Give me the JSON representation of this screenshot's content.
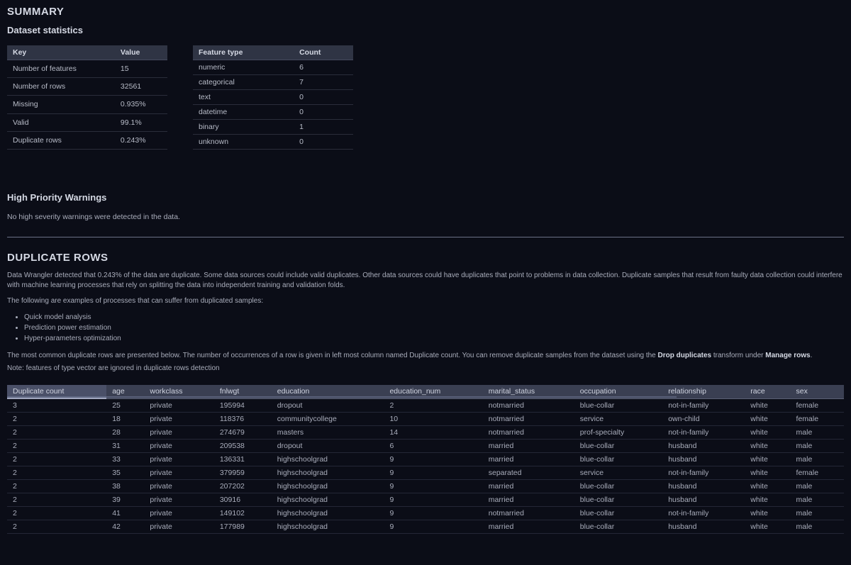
{
  "summary": {
    "title": "SUMMARY",
    "subtitle": "Dataset statistics",
    "stats_table": {
      "headers": [
        "Key",
        "Value"
      ],
      "rows": [
        [
          "Number of features",
          "15"
        ],
        [
          "Number of rows",
          "32561"
        ],
        [
          "Missing",
          "0.935%"
        ],
        [
          "Valid",
          "99.1%"
        ],
        [
          "Duplicate rows",
          "0.243%"
        ]
      ]
    },
    "types_table": {
      "headers": [
        "Feature type",
        "Count"
      ],
      "rows": [
        [
          "numeric",
          "6"
        ],
        [
          "categorical",
          "7"
        ],
        [
          "text",
          "0"
        ],
        [
          "datetime",
          "0"
        ],
        [
          "binary",
          "1"
        ],
        [
          "unknown",
          "0"
        ]
      ]
    }
  },
  "warnings": {
    "title": "High Priority Warnings",
    "message": "No high severity warnings were detected in the data."
  },
  "duplicates": {
    "title": "DUPLICATE ROWS",
    "intro": "Data Wrangler detected that 0.243% of the data are duplicate. Some data sources could include valid duplicates. Other data sources could have duplicates that point to problems in data collection. Duplicate samples that result from faulty data collection could interfere with machine learning processes that rely on splitting the data into independent training and validation folds.",
    "intro2": "The following are examples of processes that can suffer from duplicated samples:",
    "bullets": [
      "Quick model analysis",
      "Prediction power estimation",
      "Hyper-parameters optimization"
    ],
    "note1_a": "The most common duplicate rows are presented below. The number of occurrences of a row is given in left most column named Duplicate count. You can remove duplicate samples from the dataset using the ",
    "note1_b": "Drop duplicates",
    "note1_c": " transform under ",
    "note1_d": "Manage rows",
    "note1_e": ".",
    "note2": "Note: features of type vector are ignored in duplicate rows detection",
    "columns": [
      "Duplicate count",
      "age",
      "workclass",
      "fnlwgt",
      "education",
      "education_num",
      "marital_status",
      "occupation",
      "relationship",
      "race",
      "sex"
    ],
    "rows": [
      [
        "3",
        "25",
        "private",
        "195994",
        "dropout",
        "2",
        "notmarried",
        "blue-collar",
        "not-in-family",
        "white",
        "female"
      ],
      [
        "2",
        "18",
        "private",
        "118376",
        "communitycollege",
        "10",
        "notmarried",
        "service",
        "own-child",
        "white",
        "female"
      ],
      [
        "2",
        "28",
        "private",
        "274679",
        "masters",
        "14",
        "notmarried",
        "prof-specialty",
        "not-in-family",
        "white",
        "male"
      ],
      [
        "2",
        "31",
        "private",
        "209538",
        "dropout",
        "6",
        "married",
        "blue-collar",
        "husband",
        "white",
        "male"
      ],
      [
        "2",
        "33",
        "private",
        "136331",
        "highschoolgrad",
        "9",
        "married",
        "blue-collar",
        "husband",
        "white",
        "male"
      ],
      [
        "2",
        "35",
        "private",
        "379959",
        "highschoolgrad",
        "9",
        "separated",
        "service",
        "not-in-family",
        "white",
        "female"
      ],
      [
        "2",
        "38",
        "private",
        "207202",
        "highschoolgrad",
        "9",
        "married",
        "blue-collar",
        "husband",
        "white",
        "male"
      ],
      [
        "2",
        "39",
        "private",
        "30916",
        "highschoolgrad",
        "9",
        "married",
        "blue-collar",
        "husband",
        "white",
        "male"
      ],
      [
        "2",
        "41",
        "private",
        "149102",
        "highschoolgrad",
        "9",
        "notmarried",
        "blue-collar",
        "not-in-family",
        "white",
        "male"
      ],
      [
        "2",
        "42",
        "private",
        "177989",
        "highschoolgrad",
        "9",
        "married",
        "blue-collar",
        "husband",
        "white",
        "male"
      ]
    ]
  }
}
